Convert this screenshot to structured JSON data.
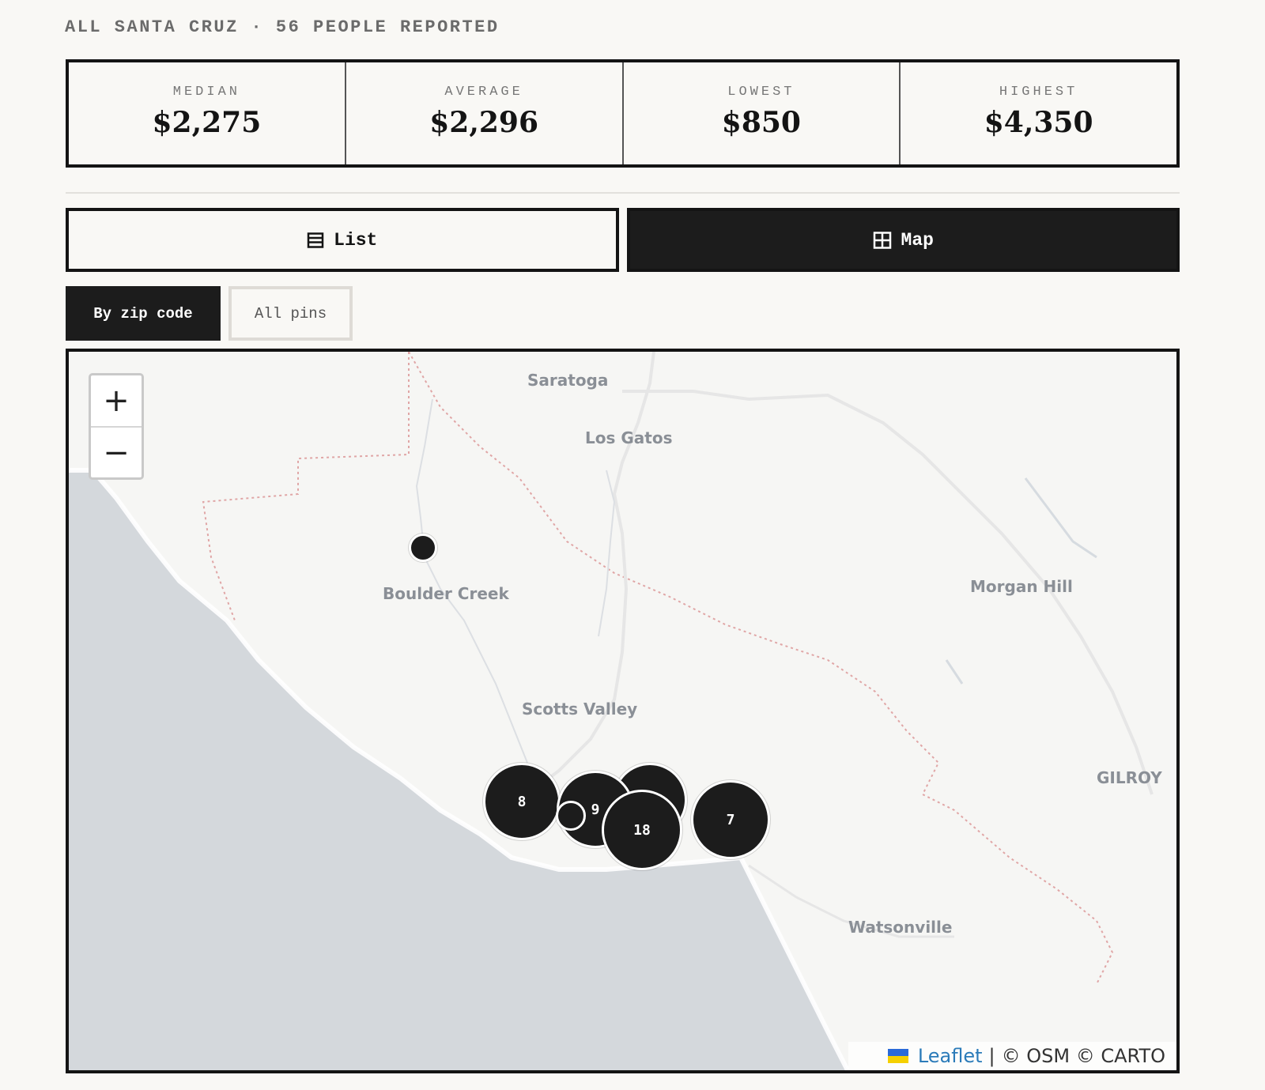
{
  "header": {
    "region": "ALL SANTA CRUZ",
    "separator": "·",
    "count_text": "56 PEOPLE REPORTED",
    "full": "ALL SANTA CRUZ · 56 PEOPLE REPORTED"
  },
  "stats": [
    {
      "label": "MEDIAN",
      "value": "$2,275"
    },
    {
      "label": "AVERAGE",
      "value": "$2,296"
    },
    {
      "label": "LOWEST",
      "value": "$850"
    },
    {
      "label": "HIGHEST",
      "value": "$4,350"
    }
  ],
  "view_toggle": {
    "list_label": "List",
    "map_label": "Map",
    "active": "map",
    "list_icon": "list-icon",
    "map_icon": "grid-icon"
  },
  "map_mode": {
    "by_zip_label": "By zip code",
    "all_pins_label": "All pins",
    "active": "by_zip"
  },
  "map": {
    "zoom_in_label": "+",
    "zoom_out_label": "−",
    "places": [
      "Saratoga",
      "Los Gatos",
      "Boulder Creek",
      "Morgan Hill",
      "Scotts Valley",
      "GILROY",
      "Watsonville"
    ],
    "clusters": [
      {
        "count": "8"
      },
      {
        "count": "9"
      },
      {
        "count": ""
      },
      {
        "count": "18"
      },
      {
        "count": "7"
      },
      {
        "count": ""
      },
      {
        "count": ""
      }
    ],
    "attribution": {
      "leaflet": "Leaflet",
      "separator": "|",
      "credits": "© OSM © CARTO"
    },
    "colors": {
      "land": "#f6f6f4",
      "water": "#d4d8dc",
      "marker": "#1c1c1c",
      "label": "#8a8f96",
      "boundary": "#e0a6a6"
    }
  }
}
